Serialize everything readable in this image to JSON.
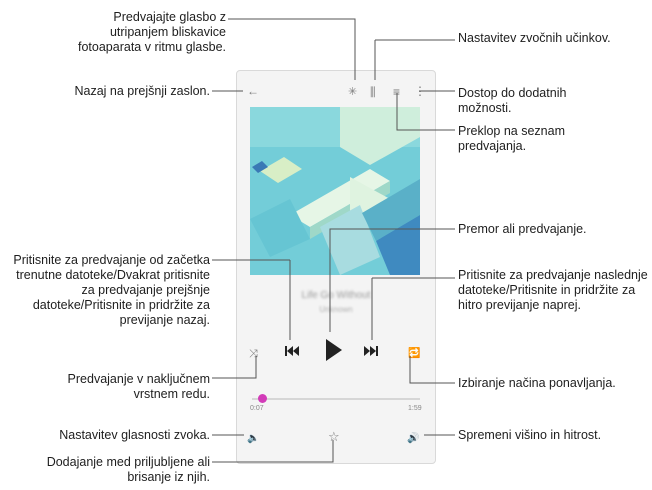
{
  "annotations": {
    "camera_flash": "Predvajajte glasbo z utripanjem bliskavice fotoaparata v ritmu glasbe.",
    "sound_effects": "Nastavitev zvočnih učinkov.",
    "back": "Nazaj na prejšnji zaslon.",
    "more_options": "Dostop do dodatnih možnosti.",
    "playlist": "Preklop na seznam predvajanja.",
    "previous": "Pritisnite za predvajanje od začetka trenutne datoteke/Dvakrat pritisnite za predvajanje prejšnje datoteke/Pritisnite in pridržite za previjanje nazaj.",
    "play_pause": "Premor ali predvajanje.",
    "next": "Pritisnite za predvajanje naslednje datoteke/Pritisnite in pridržite za hitro previjanje naprej.",
    "shuffle": "Predvajanje v naključnem vrstnem redu.",
    "repeat": "Izbiranje načina ponavljanja.",
    "volume": "Nastavitev glasnosti zvoka.",
    "speed": "Spremeni višino in hitrost.",
    "favorite": "Dodajanje med priljubljene ali brisanje iz njih."
  },
  "player": {
    "song_title": "Life Go Without",
    "artist": "Unknown",
    "elapsed": "0:07",
    "duration": "1:59",
    "progress": 0.06
  },
  "icons": {
    "back": "←",
    "flash": "✳",
    "equalizer": "⫼",
    "playlist": "≡",
    "more": "⋮",
    "shuffle": "⤨",
    "previous": "⏮",
    "play": "▶",
    "next": "⏭",
    "repeat": "🔁",
    "volume": "🔈",
    "favorite": "☆",
    "speed": "🔊"
  },
  "colors": {
    "accent": "#d23bb8",
    "artwork_bg": "#73cdd8",
    "artwork_shape": "#d9f0de"
  }
}
